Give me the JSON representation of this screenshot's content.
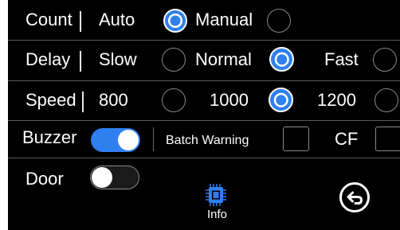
{
  "count": {
    "label": "Count",
    "options": [
      "Auto",
      "Manual"
    ],
    "selected": "Auto"
  },
  "delay": {
    "label": "Delay",
    "options": [
      "Slow",
      "Normal",
      "Fast"
    ],
    "selected": "Normal"
  },
  "speed": {
    "label": "Speed",
    "options": [
      "800",
      "1000",
      "1200"
    ],
    "selected": "1000"
  },
  "buzzer": {
    "label": "Buzzer",
    "on": true
  },
  "batch_warning": {
    "label": "Batch Warning",
    "checked": false
  },
  "cf": {
    "label": "CF",
    "checked": false
  },
  "door": {
    "label": "Door",
    "on": false
  },
  "footer": {
    "info_label": "Info",
    "info_icon": "chip-icon",
    "back_icon": "back-arrow-icon"
  },
  "colors": {
    "background": "#000000",
    "accent": "#2f7ff0",
    "text": "#ffffff",
    "separator": "#5a5a5a"
  }
}
